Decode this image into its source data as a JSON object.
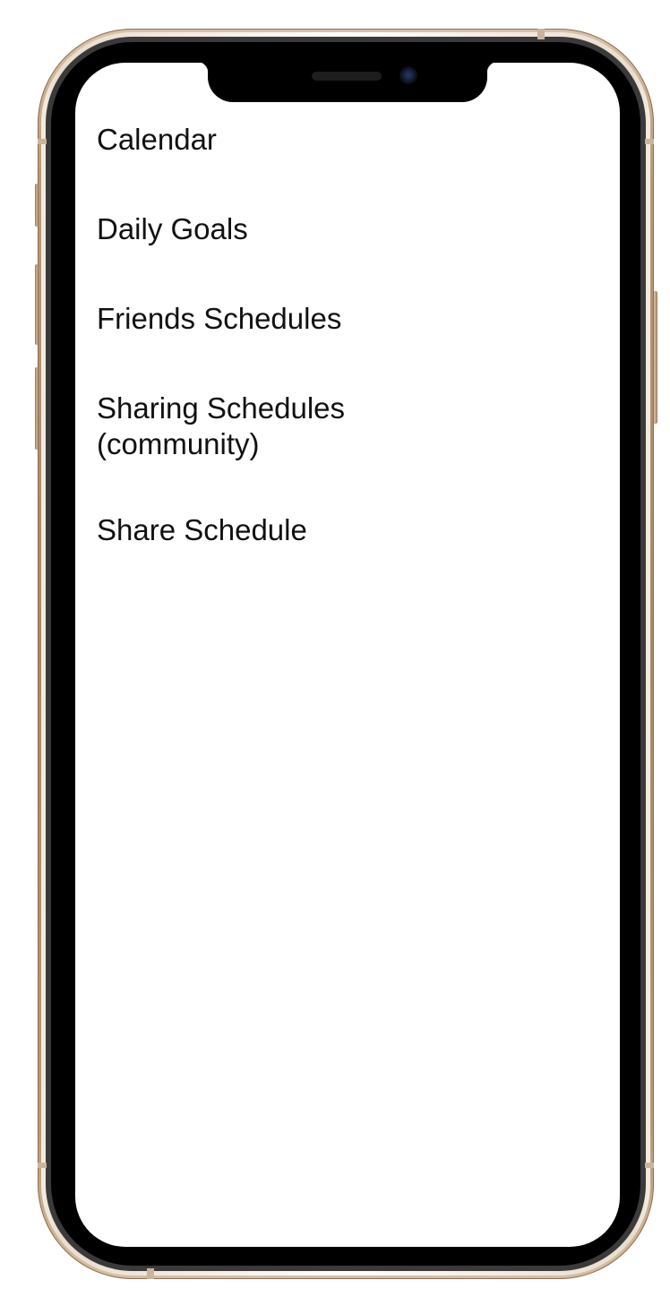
{
  "menu": {
    "items": [
      {
        "label": "Calendar"
      },
      {
        "label": "Daily Goals"
      },
      {
        "label": "Friends Schedules"
      },
      {
        "label": "Sharing Schedules (community)"
      },
      {
        "label": "Share Schedule"
      }
    ]
  },
  "colors": {
    "frame_gold": "#b89878",
    "bezel": "#000000",
    "screen_background": "#ffffff",
    "text": "#111111"
  }
}
